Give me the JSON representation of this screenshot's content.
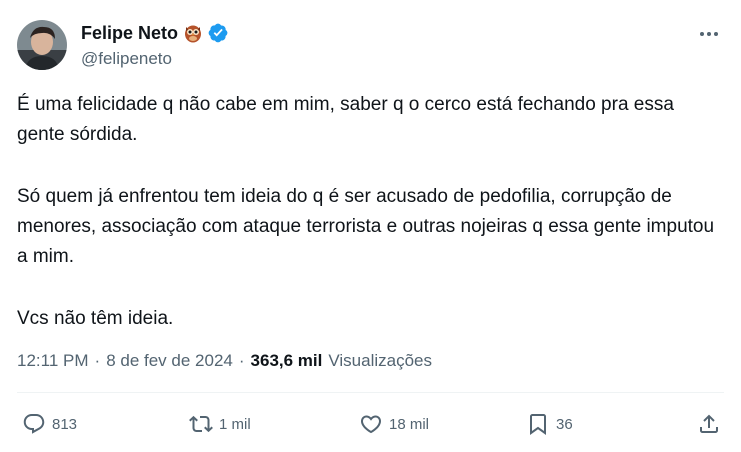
{
  "author": {
    "name": "Felipe Neto",
    "handle": "@felipeneto",
    "name_emoji": "owl",
    "verified_icon": "verified-badge-icon",
    "verified_color": "#1d9bf0"
  },
  "tweet": {
    "paragraphs": [
      "É uma felicidade q não cabe em mim, saber q o cerco está fechando pra essa gente sórdida.",
      "Só quem já enfrentou tem ideia do q é ser acusado de pedofilia, corrupção de menores, associação com ataque terrorista e outras nojeiras q essa gente imputou a mim.",
      "Vcs não têm ideia."
    ]
  },
  "meta": {
    "time": "12:11 PM",
    "separator": "·",
    "date": "8 de fev de 2024",
    "views_count": "363,6 mil",
    "views_label": "Visualizações"
  },
  "actions": {
    "replies": "813",
    "reposts": "1 mil",
    "likes": "18 mil",
    "bookmarks": "36"
  },
  "colors": {
    "text": "#0f1419",
    "secondary": "#536471",
    "divider": "#eff3f4"
  }
}
